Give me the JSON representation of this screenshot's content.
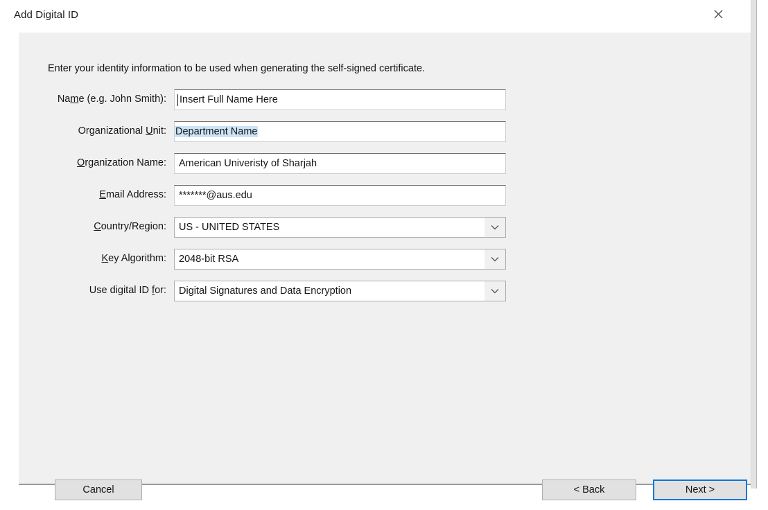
{
  "window": {
    "title": "Add Digital ID",
    "close_icon": "close-icon"
  },
  "dialog": {
    "intro": "Enter your identity information to be used when generating the self-signed certificate.",
    "fields": [
      {
        "id": "name",
        "label_before": "Na",
        "label_accel": "m",
        "label_after": "e (e.g. John Smith):",
        "type": "text",
        "value": "Insert Full Name Here",
        "placeholder": "Insert Full Name Here",
        "caret": true,
        "selected": false
      },
      {
        "id": "organizational-unit",
        "label_before": "Organizational ",
        "label_accel": "U",
        "label_after": "nit:",
        "type": "text",
        "value": "Department Name",
        "placeholder": "Department Name",
        "caret": false,
        "selected": true
      },
      {
        "id": "organization-name",
        "label_before": "",
        "label_accel": "O",
        "label_after": "rganization Name:",
        "type": "text",
        "value": "American Univeristy of Sharjah",
        "placeholder": "Organization Name",
        "caret": false,
        "selected": false
      },
      {
        "id": "email-address",
        "label_before": "",
        "label_accel": "E",
        "label_after": "mail Address:",
        "type": "text",
        "value": "*******@aus.edu",
        "placeholder": "Email Address",
        "caret": false,
        "selected": false
      },
      {
        "id": "country-region",
        "label_before": "",
        "label_accel": "C",
        "label_after": "ountry/Region:",
        "type": "combo",
        "value": "US - UNITED STATES",
        "arrow_icon": "chevron-down-icon"
      },
      {
        "id": "key-algorithm",
        "label_before": "",
        "label_accel": "K",
        "label_after": "ey Algorithm:",
        "type": "combo",
        "value": "2048-bit RSA",
        "arrow_icon": "chevron-down-icon"
      },
      {
        "id": "use-digital-id-for",
        "label_before": "Use digital ID ",
        "label_accel": "f",
        "label_after": "or:",
        "type": "combo",
        "value": "Digital Signatures and Data Encryption",
        "arrow_icon": "chevron-down-icon"
      }
    ],
    "buttons": {
      "cancel": "Cancel",
      "back": "< Back",
      "next": "Next >"
    }
  },
  "colors": {
    "focus_ring": "#0078d7",
    "selection": "#cce4f7",
    "body_bg": "#f0f0f0",
    "titlebar_bg": "#ffffff"
  }
}
